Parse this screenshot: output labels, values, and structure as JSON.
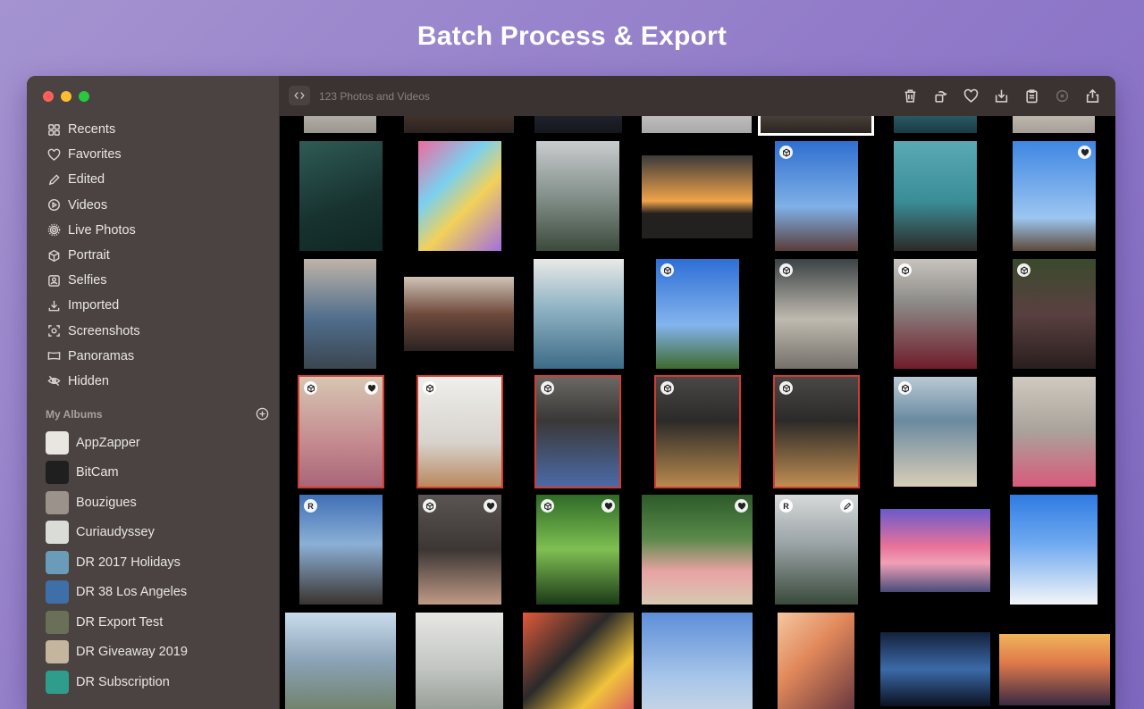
{
  "headline": "Batch Process & Export",
  "toolbar": {
    "count": "123 Photos and Videos"
  },
  "sidebar": {
    "items": [
      {
        "label": "Recents",
        "icon": "recents-icon"
      },
      {
        "label": "Favorites",
        "icon": "heart-icon"
      },
      {
        "label": "Edited",
        "icon": "pencil-icon"
      },
      {
        "label": "Videos",
        "icon": "play-icon"
      },
      {
        "label": "Live Photos",
        "icon": "live-photo-icon"
      },
      {
        "label": "Portrait",
        "icon": "cube-icon"
      },
      {
        "label": "Selfies",
        "icon": "selfie-icon"
      },
      {
        "label": "Imported",
        "icon": "import-icon"
      },
      {
        "label": "Screenshots",
        "icon": "screenshot-icon"
      },
      {
        "label": "Panoramas",
        "icon": "panorama-icon"
      },
      {
        "label": "Hidden",
        "icon": "eye-slash-icon"
      }
    ],
    "my_albums_label": "My Albums",
    "albums": [
      {
        "label": "AppZapper",
        "color": "#e9e6e2"
      },
      {
        "label": "BitCam",
        "color": "#1f1f1f"
      },
      {
        "label": "Bouzigues",
        "color": "#9a928b"
      },
      {
        "label": "Curiaudyssey",
        "color": "#d9dcd7"
      },
      {
        "label": "DR 2017 Holidays",
        "color": "#6a9bb8"
      },
      {
        "label": "DR 38 Los Angeles",
        "color": "#3f6fa8"
      },
      {
        "label": "DR Export Test",
        "color": "#6a7057"
      },
      {
        "label": "DR Giveaway 2019",
        "color": "#c4b59e"
      },
      {
        "label": "DR Subscription",
        "color": "#2f9d8c"
      }
    ]
  },
  "colors": {
    "sidebar": "#4a4342",
    "toolbar": "#3a3332",
    "selection": "#d43b30",
    "grid": "#000000"
  },
  "photos": [
    {
      "name": "photo-top-1",
      "bg": "linear-gradient(#cfcac4,#9b958f)"
    },
    {
      "name": "photo-top-2",
      "bg": "linear-gradient(#5a4638,#2c2220)"
    },
    {
      "name": "photo-top-3",
      "bg": "linear-gradient(#2d3240,#14161c)"
    },
    {
      "name": "photo-top-4",
      "bg": "linear-gradient(#d9d9d9,#a8a8a8)"
    },
    {
      "name": "photo-top-5",
      "bg": "linear-gradient(#6a6158,#2b2420)"
    },
    {
      "name": "photo-top-6",
      "bg": "linear-gradient(#3a7d8c,#1b3b44)"
    },
    {
      "name": "photo-top-7",
      "bg": "linear-gradient(#ddd6cc,#a59e96)"
    },
    {
      "name": "photo-surfer",
      "bg": "linear-gradient(160deg,#2f5b56,#17322f 60%,#0f2725)"
    },
    {
      "name": "photo-graffiti-wall",
      "bg": "linear-gradient(135deg,#f06aa0,#7ad0ef 35%,#f2d15a 60%,#a36ee0)"
    },
    {
      "name": "photo-hollywood-sign",
      "bg": "linear-gradient(#c9ccce,#7d8a84 55%,#3c4a3c)"
    },
    {
      "name": "photo-sunset-palms",
      "bg": "linear-gradient(#3b3a3a,#f0a34a 55%,#232020 70%)"
    },
    {
      "name": "photo-palms-sky",
      "bg": "linear-gradient(#2f6fd0,#7fb0e6 60%,#5a3d3a)"
    },
    {
      "name": "photo-vintage-car",
      "bg": "linear-gradient(#5aa9b6,#3a8d97 55%,#2c2a28)"
    },
    {
      "name": "photo-palm-trees",
      "bg": "linear-gradient(#3f86e3,#9cc6f1 70%,#5d4a3a)"
    },
    {
      "name": "photo-girl-pier",
      "bg": "linear-gradient(#bfb4a8,#4f6d8c 55%,#3b4650)"
    },
    {
      "name": "photo-crowd",
      "bg": "linear-gradient(#cfc3b6,#6e4a3c 50%,#2c2322)"
    },
    {
      "name": "photo-woman-sea",
      "bg": "linear-gradient(#e9e9e6,#8fb3c4 45%,#3d6b86)"
    },
    {
      "name": "photo-girl-palms",
      "bg": "linear-gradient(#2e6fd6,#83b4ee 60%,#3f6a2e)"
    },
    {
      "name": "photo-woman-coat",
      "bg": "linear-gradient(#3c4245,#bfbab0 55%,#74706a)"
    },
    {
      "name": "photo-woman-red-suit",
      "bg": "linear-gradient(#c8c3bd,#8c8a88 40%,#6f1d2b)"
    },
    {
      "name": "photo-woman-red-beret",
      "bg": "linear-gradient(#3a4a2c,#5a4040 50%,#2a1e1e)"
    },
    {
      "name": "photo-child-hat",
      "bg": "linear-gradient(#d7c6b2,#c48a8f 60%,#a86678)"
    },
    {
      "name": "photo-man-dog",
      "bg": "linear-gradient(#efefeb,#d7d2cc 60%,#b9895f)"
    },
    {
      "name": "photo-man-yellow-beanie",
      "bg": "linear-gradient(#6a6864,#3a3836 40%,#4c6aa8)"
    },
    {
      "name": "photo-man-camel-coat",
      "bg": "linear-gradient(#4a4846,#2b2a28 40%,#b88a4e)"
    },
    {
      "name": "photo-man-camel-coat-2",
      "bg": "linear-gradient(#4a4846,#2b2a28 40%,#c08e52)"
    },
    {
      "name": "photo-woman-beach",
      "bg": "linear-gradient(#b9c9d4,#6a8aa0 40%,#d9cdb8)"
    },
    {
      "name": "photo-woman-pink",
      "bg": "linear-gradient(#cfc9c0,#a9a29a 50%,#d95a7c)"
    },
    {
      "name": "photo-ruin-tower",
      "bg": "linear-gradient(#3f6fb6,#8bb0d6 45%,#3a3430)"
    },
    {
      "name": "photo-man-glasses",
      "bg": "linear-gradient(#5a5552,#3c3634 50%,#c09a86)"
    },
    {
      "name": "photo-leaf-butterfly",
      "bg": "linear-gradient(#2f6b28,#7fbf52 50%,#1d3a18)"
    },
    {
      "name": "photo-flamingos",
      "bg": "linear-gradient(#2d5a2a,#5a8a4a 40%,#e8a3a3 70%,#d7c9b2)"
    },
    {
      "name": "photo-coast",
      "bg": "linear-gradient(#d7d9d9,#9aa3a6 45%,#3a4a3c)"
    },
    {
      "name": "photo-pink-sky",
      "bg": "linear-gradient(#6a5acb,#e8729a 45%,#f0a0b6 65%,#4a4c7a)"
    },
    {
      "name": "photo-santorini",
      "bg": "linear-gradient(#2f7be3,#6faaf0 45%,#f3f5f7)"
    },
    {
      "name": "photo-mountains",
      "bg": "linear-gradient(#c9dcec,#8aa2b6 45%,#6a7a5a)"
    },
    {
      "name": "photo-staircase",
      "bg": "linear-gradient(#e7e7e4,#c3c6c3 50%,#8c938c)"
    },
    {
      "name": "photo-graffiti-man",
      "bg": "linear-gradient(135deg,#e05a3a,#2a2a2a 40%,#f0c33a 70%,#d34a6a)"
    },
    {
      "name": "photo-building",
      "bg": "linear-gradient(#5d8fd8,#a8c6ea 60%,#cfd9e3)"
    },
    {
      "name": "photo-woman-lights",
      "bg": "linear-gradient(135deg,#f5c7a0,#e0875a 40%,#5a2e3a)"
    },
    {
      "name": "photo-aurora",
      "bg": "linear-gradient(#15213c,#3b6aa8 50%,#0b1220)"
    },
    {
      "name": "photo-mountain-sunset",
      "bg": "linear-gradient(#f0b45a,#e07a4a 40%,#3a2a44)"
    }
  ]
}
